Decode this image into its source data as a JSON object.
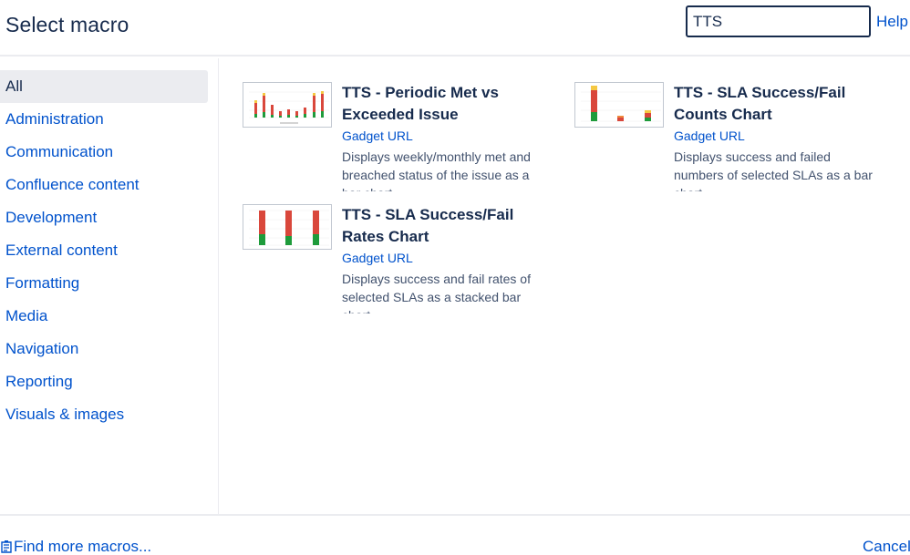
{
  "header": {
    "title": "Select macro",
    "search_value": "TTS",
    "help_label": "Help"
  },
  "sidebar": {
    "items": [
      {
        "label": "All",
        "selected": true
      },
      {
        "label": "Administration"
      },
      {
        "label": "Communication"
      },
      {
        "label": "Confluence content"
      },
      {
        "label": "Development"
      },
      {
        "label": "External content"
      },
      {
        "label": "Formatting"
      },
      {
        "label": "Media"
      },
      {
        "label": "Navigation"
      },
      {
        "label": "Reporting"
      },
      {
        "label": "Visuals & images"
      }
    ]
  },
  "macros": [
    {
      "title": "TTS - Periodic Met vs Exceeded Issue",
      "url_label": "Gadget URL",
      "description": "Displays weekly/monthly met and breached status of the issue as a bar chart."
    },
    {
      "title": "TTS - SLA Success/Fail Counts Chart",
      "url_label": "Gadget URL",
      "description": "Displays success and failed numbers of selected SLAs as a bar chart."
    },
    {
      "title": "TTS - SLA Success/Fail Rates Chart",
      "url_label": "Gadget URL",
      "description": "Displays success and fail rates of selected SLAs as a stacked bar chart."
    }
  ],
  "footer": {
    "find_more_label": "Find more macros...",
    "cancel_label": "Cancel"
  },
  "colors": {
    "link": "#0052cc",
    "text": "#172b4d",
    "selected_bg": "#ebecf0",
    "bar_red": "#d9473b",
    "bar_green": "#1e9b3b",
    "bar_yellow": "#f5c842",
    "bar_orange": "#f08a3c"
  },
  "icons": {
    "find_more": "marketplace-icon"
  }
}
